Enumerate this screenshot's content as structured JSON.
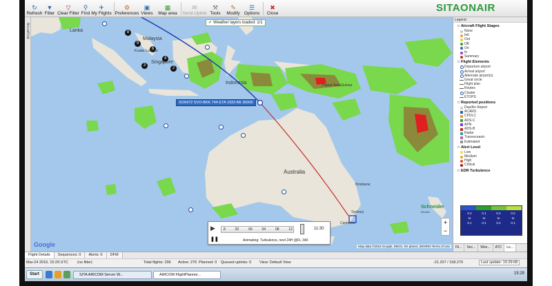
{
  "toolbar": {
    "buttons": [
      {
        "label": "Refresh",
        "icon": "refresh-icon"
      },
      {
        "label": "Filter",
        "icon": "filter-icon"
      },
      {
        "label": "Clear Filter",
        "icon": "clear-filter-icon"
      },
      {
        "label": "Find",
        "icon": "find-icon"
      },
      {
        "label": "My Flights",
        "icon": "my-flights-icon"
      },
      {
        "label": "Preferences",
        "icon": "preferences-icon"
      },
      {
        "label": "Views",
        "icon": "views-icon"
      },
      {
        "label": "Map area",
        "icon": "map-area-icon"
      },
      {
        "label": "Send Uplink",
        "icon": "send-uplink-icon",
        "disabled": true
      },
      {
        "label": "Tools",
        "icon": "tools-icon"
      },
      {
        "label": "Modify",
        "icon": "modify-icon"
      },
      {
        "label": "Options",
        "icon": "options-icon"
      },
      {
        "label": "Close",
        "icon": "close-icon"
      }
    ],
    "logo": "SITAONAIR"
  },
  "left_tab": "Aircraft list",
  "map": {
    "notification": "Weather layers loaded: 1/1",
    "flight_label": "XO0472 SVO-BKK 744 ETA 1933 AB 36000",
    "place_labels": [
      "Lanka",
      "Malaysia",
      "Kuala Lumpur",
      "Singapore",
      "Indonesia",
      "Papua New Guinea",
      "Australia",
      "Brisbane",
      "Sydney",
      "Canberra"
    ],
    "google": "Google",
    "map_data": "Map data ©2016 Google, INEGI, SK planet, ZENRIN   Terms of Use",
    "brand": "Schneider",
    "brand_sub": "Electric",
    "animation": {
      "ticks": [
        "8",
        "20",
        "00",
        "04",
        "08",
        "12"
      ],
      "time": "11:30",
      "caption": "Animating: Turbulence, next 24H @FL 340"
    }
  },
  "legend": {
    "header": "Legend",
    "sections": [
      {
        "title": "Aircraft Flight Stages",
        "items": [
          {
            "label": "None",
            "color": "#c8c8c8"
          },
          {
            "label": "Init",
            "color": "#f0a030"
          },
          {
            "label": "Out",
            "color": "#e0d020"
          },
          {
            "label": "Off",
            "color": "#3a9a3a"
          },
          {
            "label": "On",
            "color": "#3060c0"
          },
          {
            "label": "In",
            "color": "#a040c0"
          },
          {
            "label": "Summary",
            "color": "#c03030"
          }
        ]
      },
      {
        "title": "Flight Elements",
        "items": [
          {
            "label": "Departure airport"
          },
          {
            "label": "Arrival airport"
          },
          {
            "label": "Alternate airport(s)"
          },
          {
            "label": "Great circle"
          },
          {
            "label": "Flight plan"
          },
          {
            "label": "Routes"
          },
          {
            "label": "Cluster"
          },
          {
            "label": "ETOPS"
          }
        ]
      },
      {
        "title": "Reported positions",
        "items": [
          {
            "label": "Dep/Arr Airport",
            "color": "#d0d0d0"
          },
          {
            "label": "ACARS",
            "color": "#2a60c0"
          },
          {
            "label": "CPDLC",
            "color": "#e0a020"
          },
          {
            "label": "ADS-C",
            "color": "#3aa03a"
          },
          {
            "label": "APN",
            "color": "#7a3ac0"
          },
          {
            "label": "ADS-B",
            "color": "#d02020"
          },
          {
            "label": "Radar",
            "color": "#20a0a0"
          },
          {
            "label": "Transoceanic",
            "color": "#c060a0"
          },
          {
            "label": "Estimated",
            "color": "#909090"
          }
        ]
      },
      {
        "title": "Alert Level",
        "items": [
          {
            "label": "Low",
            "color": "#e8e040"
          },
          {
            "label": "Medium",
            "color": "#f0a030"
          },
          {
            "label": "High",
            "color": "#e05020"
          },
          {
            "label": "Critical",
            "color": "#b01010"
          }
        ]
      }
    ],
    "edr_title": "EDR Turbulence",
    "edr_values": [
      "0.2",
      "0.1",
      "0.2",
      "0.2",
      "to",
      "to",
      "to",
      "to",
      "0.1",
      "0.1",
      "0.2",
      "0.1"
    ],
    "tabs": [
      "Fli...",
      "Sec...",
      "Wee...",
      "ATC",
      "Le..."
    ]
  },
  "bottom_tabs": [
    "Flight Details",
    "Sequences: 0",
    "Alerts: 0",
    "DFM"
  ],
  "status": {
    "datetime": "Mar-24 2016, 15:29 UTC",
    "filter": "(no filter)",
    "total": "Total flights: 296",
    "active": "Active: 276",
    "planned": "Planned: 0",
    "queued": "Queued uplinks: 0",
    "view": "View: Default View",
    "coords": "-21.207 / 158.270",
    "last_update": "Last update: 15:29:08"
  },
  "taskbar": {
    "start": "Start",
    "tasks": [
      "SITA AIRCOM Server W...",
      "AIRCOM FlightPlanner..."
    ],
    "clock": "15:29"
  }
}
